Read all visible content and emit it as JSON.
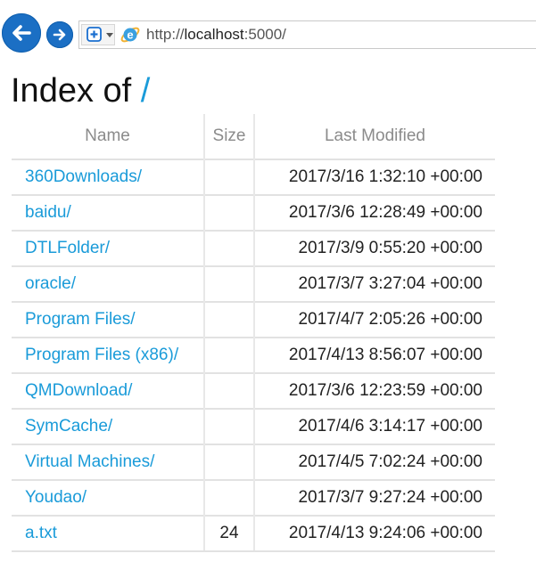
{
  "browser": {
    "url_scheme": "http://",
    "url_host": "localhost",
    "url_rest": ":5000/",
    "back_icon": "arrow-left-icon",
    "forward_icon": "arrow-right-icon",
    "favorites_icon": "plus-shield-icon",
    "ie_icon": "internet-explorer-icon",
    "accent_color": "#1b6fc4"
  },
  "page": {
    "title_prefix": "Index of",
    "title_path": "/",
    "link_color": "#1a9bd9"
  },
  "table": {
    "headers": {
      "name": "Name",
      "size": "Size",
      "modified": "Last Modified"
    },
    "rows": [
      {
        "name": "360Downloads/",
        "size": "",
        "modified": "2017/3/16 1:32:10 +00:00"
      },
      {
        "name": "baidu/",
        "size": "",
        "modified": "2017/3/6 12:28:49 +00:00"
      },
      {
        "name": "DTLFolder/",
        "size": "",
        "modified": "2017/3/9 0:55:20 +00:00"
      },
      {
        "name": "oracle/",
        "size": "",
        "modified": "2017/3/7 3:27:04 +00:00"
      },
      {
        "name": "Program Files/",
        "size": "",
        "modified": "2017/4/7 2:05:26 +00:00"
      },
      {
        "name": "Program Files (x86)/",
        "size": "",
        "modified": "2017/4/13 8:56:07 +00:00"
      },
      {
        "name": "QMDownload/",
        "size": "",
        "modified": "2017/3/6 12:23:59 +00:00"
      },
      {
        "name": "SymCache/",
        "size": "",
        "modified": "2017/4/6 3:14:17 +00:00"
      },
      {
        "name": "Virtual Machines/",
        "size": "",
        "modified": "2017/4/5 7:02:24 +00:00"
      },
      {
        "name": "Youdao/",
        "size": "",
        "modified": "2017/3/7 9:27:24 +00:00"
      },
      {
        "name": "a.txt",
        "size": "24",
        "modified": "2017/4/13 9:24:06 +00:00"
      }
    ]
  }
}
